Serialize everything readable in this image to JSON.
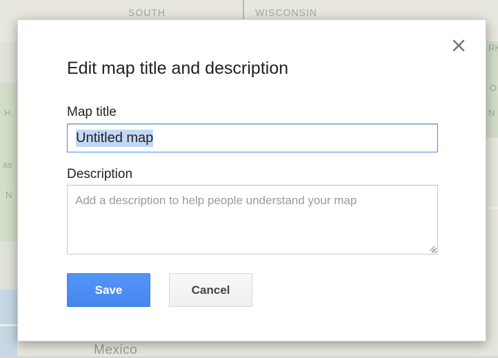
{
  "map": {
    "labels": {
      "south": "SOUTH",
      "wisconsin": "WISCONSIN",
      "mexico": "Mexico",
      "left_h": "H",
      "left_as": "as",
      "left_n": "N",
      "right_rk": "RK",
      "right_n": "N",
      "right_o": "O"
    }
  },
  "dialog": {
    "title": "Edit map title and description",
    "close_icon": "close-icon",
    "map_title_label": "Map title",
    "map_title_value": "Untitled map",
    "description_label": "Description",
    "description_placeholder": "Add a description to help people understand your map",
    "save_label": "Save",
    "cancel_label": "Cancel"
  },
  "colors": {
    "primary_button": "#4d8ef0",
    "input_focus_border": "#4d90fe",
    "selection": "#c3d8f5"
  }
}
